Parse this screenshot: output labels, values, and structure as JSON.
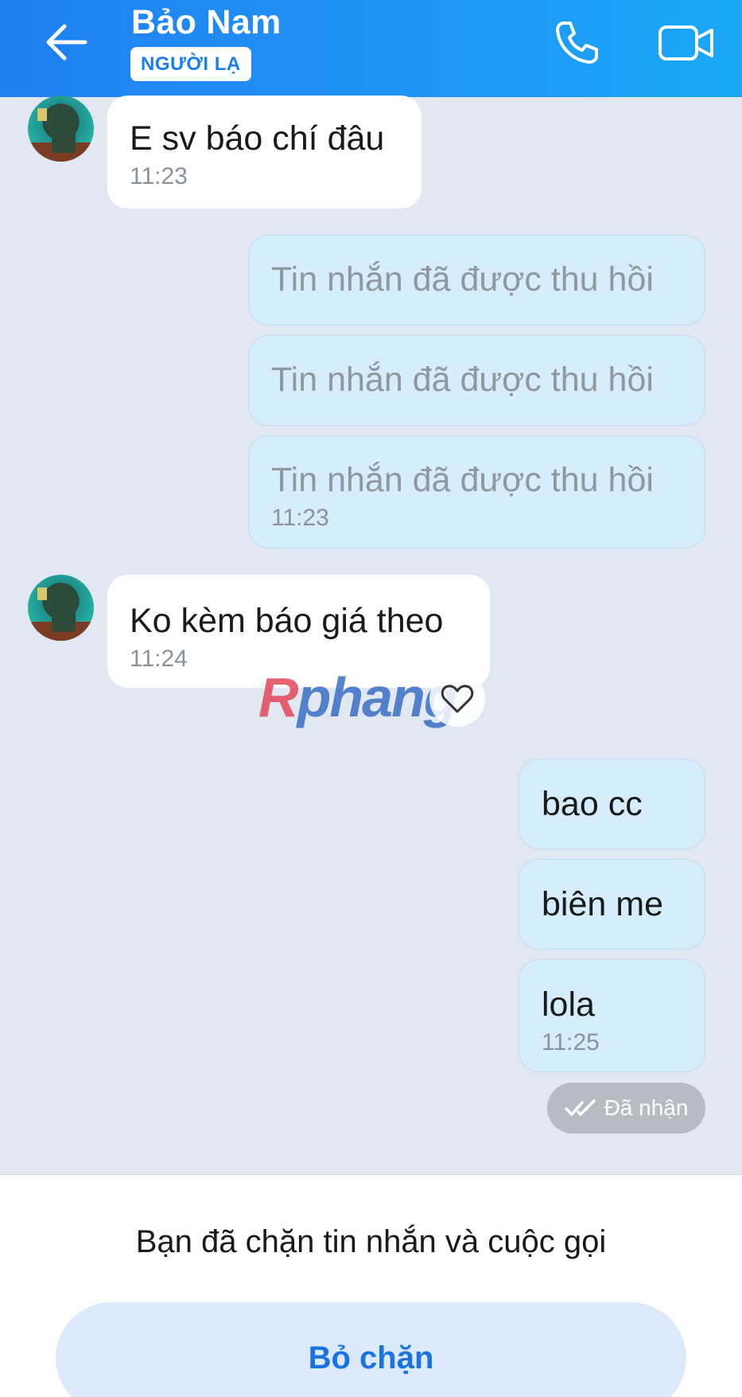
{
  "header": {
    "contact_name": "Bảo Nam",
    "badge": "NGƯỜI LẠ",
    "icons": [
      "back-arrow-icon",
      "phone-icon",
      "video-camera-icon"
    ]
  },
  "messages": [
    {
      "direction": "in",
      "text": "E sv báo chí đâu",
      "time": "11:23"
    },
    {
      "direction": "out",
      "text": "Tin nhắn đã được thu hồi",
      "recalled": true
    },
    {
      "direction": "out",
      "text": "Tin nhắn đã được thu hồi",
      "recalled": true
    },
    {
      "direction": "out",
      "text": "Tin nhắn đã được thu hồi",
      "recalled": true,
      "time": "11:23"
    },
    {
      "direction": "in",
      "text": "Ko kèm báo giá theo",
      "time": "11:24"
    },
    {
      "direction": "out",
      "text": "bao cc"
    },
    {
      "direction": "out",
      "text": "biên me"
    },
    {
      "direction": "out",
      "text": "lola",
      "time": "11:25"
    }
  ],
  "watermark": {
    "r": "R",
    "rest": "phang"
  },
  "status": {
    "label": "Đã nhận",
    "icon": "double-check-icon"
  },
  "block_panel": {
    "message": "Bạn đã chặn tin nhắn và cuộc gọi",
    "unblock_label": "Bỏ chặn"
  },
  "colors": {
    "header_start": "#1f7ff0",
    "header_end": "#1aa8f6",
    "chat_background": "#e2e8f1",
    "outgoing_bubble": "#d6edfd",
    "incoming_bubble": "#ffffff",
    "unblock_text": "#1a74e0"
  }
}
